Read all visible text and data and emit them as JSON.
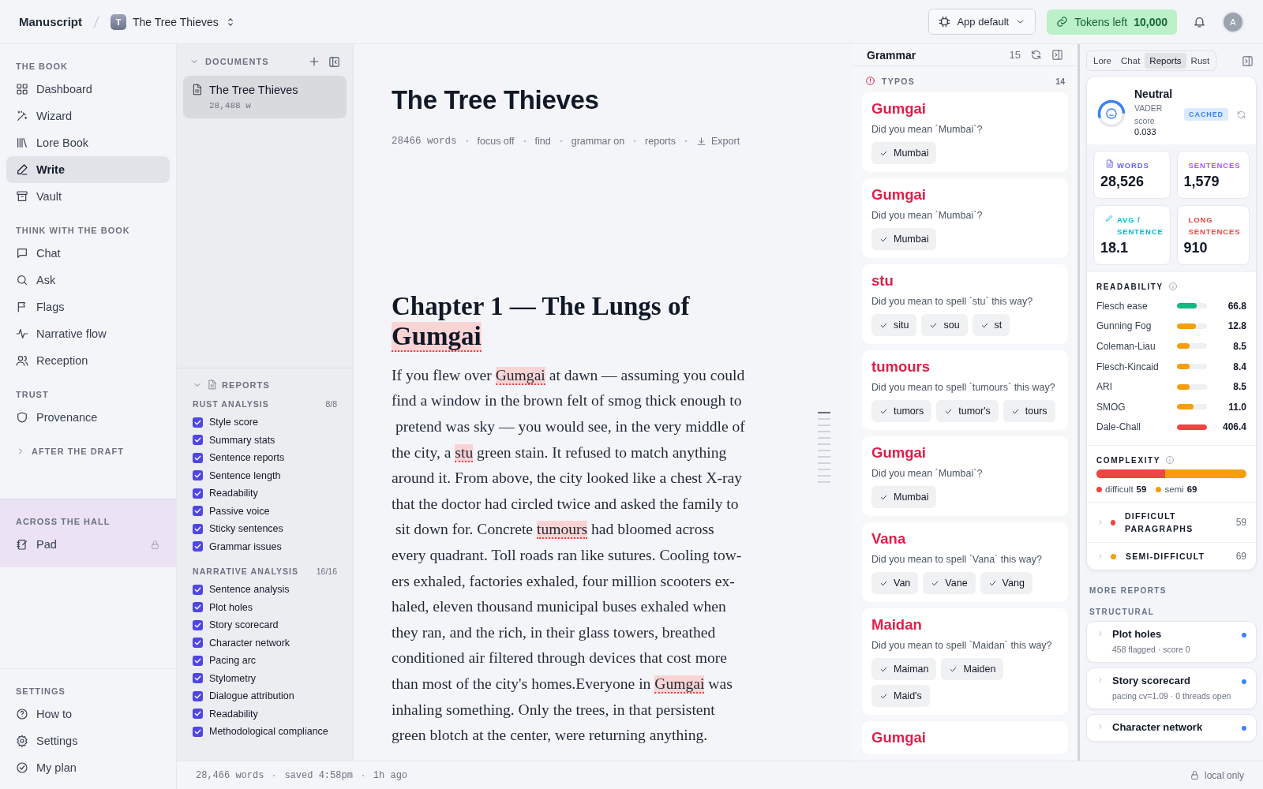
{
  "topbar": {
    "app_name": "Manuscript",
    "project": {
      "initial": "T",
      "title": "The Tree Thieves"
    },
    "model_select": {
      "value": "App default"
    },
    "tokens": {
      "label": "Tokens left",
      "value": "10,000"
    },
    "avatar": "A"
  },
  "sidebar": {
    "sections": [
      {
        "kind": "group",
        "title": "THE BOOK",
        "items": [
          {
            "label": "Dashboard",
            "selected": false
          },
          {
            "label": "Wizard",
            "selected": false
          },
          {
            "label": "Lore Book",
            "selected": false
          },
          {
            "label": "Write",
            "selected": true
          },
          {
            "label": "Vault",
            "selected": false
          }
        ]
      },
      {
        "kind": "group",
        "title": "THINK WITH THE BOOK",
        "items": [
          {
            "label": "Chat",
            "selected": false
          },
          {
            "label": "Ask",
            "selected": false
          },
          {
            "label": "Flags",
            "selected": false
          },
          {
            "label": "Narrative flow",
            "selected": false
          },
          {
            "label": "Reception",
            "selected": false
          }
        ]
      },
      {
        "kind": "group",
        "title": "TRUST",
        "items": [
          {
            "label": "Provenance",
            "selected": false
          }
        ]
      },
      {
        "kind": "collapsed",
        "title": "AFTER THE DRAFT",
        "expanded": false
      }
    ],
    "hall": {
      "title": "ACROSS THE HALL",
      "items": [
        {
          "label": "Pad",
          "locked": true
        }
      ]
    },
    "settings": {
      "title": "SETTINGS",
      "items": [
        {
          "label": "How to",
          "selected": false
        },
        {
          "label": "Settings",
          "selected": false
        },
        {
          "label": "My plan",
          "selected": false
        }
      ]
    }
  },
  "documents": {
    "title": "DOCUMENTS",
    "expanded": true,
    "items": [
      {
        "title": "The Tree Thieves",
        "meta": "28,488 w",
        "selected": true
      }
    ]
  },
  "reports": {
    "title": "REPORTS",
    "expanded": true,
    "groups": [
      {
        "title": "RUST ANALYSIS",
        "count": "8/8",
        "items": [
          {
            "label": "Style score",
            "checked": true
          },
          {
            "label": "Summary stats",
            "checked": true
          },
          {
            "label": "Sentence reports",
            "checked": true
          },
          {
            "label": "Sentence length",
            "checked": true
          },
          {
            "label": "Readability",
            "checked": true
          },
          {
            "label": "Passive voice",
            "checked": true
          },
          {
            "label": "Sticky sentences",
            "checked": true
          },
          {
            "label": "Grammar issues",
            "checked": true
          }
        ]
      },
      {
        "title": "NARRATIVE ANALYSIS",
        "count": "16/16",
        "items": [
          {
            "label": "Sentence analysis",
            "checked": true
          },
          {
            "label": "Plot holes",
            "checked": true
          },
          {
            "label": "Story scorecard",
            "checked": true
          },
          {
            "label": "Character network",
            "checked": true
          },
          {
            "label": "Pacing arc",
            "checked": true
          },
          {
            "label": "Stylometry",
            "checked": true
          },
          {
            "label": "Dialogue attribution",
            "checked": true
          },
          {
            "label": "Readability",
            "checked": true
          },
          {
            "label": "Methodological compliance",
            "checked": true
          }
        ]
      }
    ]
  },
  "editor": {
    "title": "The Tree Thieves",
    "meta": [
      {
        "kind": "count",
        "text": "28466 words"
      },
      {
        "kind": "action",
        "text": "focus off"
      },
      {
        "kind": "action",
        "text": "find"
      },
      {
        "kind": "action",
        "text": "grammar on"
      },
      {
        "kind": "action",
        "text": "reports"
      },
      {
        "kind": "export",
        "text": "Export"
      }
    ],
    "heading": [
      {
        "text": "Chapter 1 — The Lungs of "
      },
      {
        "text": "Gumgai",
        "typo": true
      }
    ],
    "lines": [
      [
        {
          "text": "If you flew over "
        },
        {
          "text": "Gumgai",
          "typo": true
        },
        {
          "text": " at dawn — assuming you could"
        }
      ],
      [
        {
          "text": "find a window in the brown felt of smog thick enough to"
        }
      ],
      [
        {
          "text": " pretend was sky — you would see, in the very middle of"
        }
      ],
      [
        {
          "text": "the city, a "
        },
        {
          "text": "stu",
          "typo": true
        },
        {
          "text": " green stain. It refused to match anything"
        }
      ],
      [
        {
          "text": "around it. From above, the city looked like a chest X-ray"
        }
      ],
      [
        {
          "text": "that the doctor had circled twice and asked the family to"
        }
      ],
      [
        {
          "text": " sit down for. Concrete "
        },
        {
          "text": "tumours",
          "typo": true
        },
        {
          "text": " had bloomed across"
        }
      ],
      [
        {
          "text": "every quadrant. Toll roads ran like sutures. Cooling tow-"
        }
      ],
      [
        {
          "text": "ers exhaled, factories exhaled, four million scooters ex-"
        }
      ],
      [
        {
          "text": "haled, eleven thousand municipal buses exhaled when"
        }
      ],
      [
        {
          "text": "they ran, and the rich, in their glass towers, breathed"
        }
      ],
      [
        {
          "text": "conditioned air filtered through devices that cost more"
        }
      ],
      [
        {
          "text": "than most of the city's homes.Everyone in "
        },
        {
          "text": "Gumgai",
          "typo": true
        },
        {
          "text": " was"
        }
      ],
      [
        {
          "text": "inhaling something. Only the trees, in that persistent"
        }
      ],
      [
        {
          "text": "green blotch at the center, were returning anything."
        }
      ]
    ]
  },
  "grammar": {
    "title": "Grammar",
    "count": "15",
    "section": {
      "title": "TYPOS",
      "count": "14"
    },
    "issues": [
      {
        "word": "Gumgai",
        "message": "Did you mean `Mumbai`?",
        "suggestions": [
          "Mumbai"
        ]
      },
      {
        "word": "Gumgai",
        "message": "Did you mean `Mumbai`?",
        "suggestions": [
          "Mumbai"
        ]
      },
      {
        "word": "stu",
        "message": "Did you mean to spell `stu` this way?",
        "suggestions": [
          "situ",
          "sou",
          "st"
        ]
      },
      {
        "word": "tumours",
        "message": "Did you mean to spell `tumours` this way?",
        "suggestions": [
          "tumors",
          "tumor's",
          "tours"
        ]
      },
      {
        "word": "Gumgai",
        "message": "Did you mean `Mumbai`?",
        "suggestions": [
          "Mumbai"
        ]
      },
      {
        "word": "Vana",
        "message": "Did you mean to spell `Vana` this way?",
        "suggestions": [
          "Van",
          "Vane",
          "Vang"
        ]
      },
      {
        "word": "Maidan",
        "message": "Did you mean to spell `Maidan` this way?",
        "suggestions": [
          "Maiman",
          "Maiden",
          "Maid's"
        ]
      },
      {
        "word": "Gumgai"
      }
    ]
  },
  "reports_panel": {
    "tabs": [
      {
        "label": "Lore",
        "selected": false
      },
      {
        "label": "Chat",
        "selected": false
      },
      {
        "label": "Reports",
        "selected": true
      },
      {
        "label": "Rust",
        "selected": false
      }
    ],
    "sentiment": {
      "label": "Neutral",
      "source": "VADER score",
      "score": "0.033",
      "badge": "CACHED",
      "level": 0.55
    },
    "stats": [
      {
        "kind": "words",
        "label": "WORDS",
        "value": "28,526",
        "color": "#6366f1"
      },
      {
        "kind": "sentences",
        "label": "SENTENCES",
        "value": "1,579",
        "color": "#a855f7"
      },
      {
        "kind": "average",
        "label": "AVG / SENTENCE",
        "value": "18.1",
        "color": "#06b6d4"
      },
      {
        "kind": "long",
        "label": "LONG SENTENCES",
        "value": "910",
        "color": "#ef4444"
      }
    ],
    "readability": {
      "title": "READABILITY",
      "rows": [
        {
          "name": "Flesch ease",
          "level": 0.66,
          "value": "66.8",
          "color": "#10b981"
        },
        {
          "name": "Gunning Fog",
          "level": 0.62,
          "value": "12.8",
          "color": "#f59e0b"
        },
        {
          "name": "Coleman-Liau",
          "level": 0.42,
          "value": "8.5",
          "color": "#f59e0b"
        },
        {
          "name": "Flesch-Kincaid",
          "level": 0.42,
          "value": "8.4",
          "color": "#f59e0b"
        },
        {
          "name": "ARI",
          "level": 0.42,
          "value": "8.5",
          "color": "#f59e0b"
        },
        {
          "name": "SMOG",
          "level": 0.55,
          "value": "11.0",
          "color": "#f59e0b"
        },
        {
          "name": "Dale-Chall",
          "level": 1,
          "value": "406.4",
          "color": "#ef4444"
        }
      ]
    },
    "complexity": {
      "title": "COMPLEXITY",
      "segments": [
        {
          "label": "difficult",
          "count": "59",
          "level": 0.46,
          "color": "#ef4444"
        },
        {
          "label": "semi",
          "count": "69",
          "color": "#f59e0b"
        }
      ]
    },
    "breakdowns": [
      {
        "label": "DIFFICULT PARAGRAPHS",
        "count": "59",
        "color": "#ef4444",
        "expanded": false
      },
      {
        "label": "SEMI-DIFFICULT",
        "count": "69",
        "color": "#f59e0b",
        "expanded": false
      }
    ],
    "more_reports": {
      "title": "MORE REPORTS",
      "group": "STRUCTURAL",
      "items": [
        {
          "title": "Plot holes",
          "meta": "458 flagged · score 0"
        },
        {
          "title": "Story scorecard",
          "meta": "pacing cv=1.09 · 0 threads open"
        },
        {
          "title": "Character network"
        }
      ]
    }
  },
  "status_bar": {
    "words": "28,466 words",
    "saved": "saved 4:58pm",
    "ago": "1h ago",
    "storage": "local only"
  }
}
